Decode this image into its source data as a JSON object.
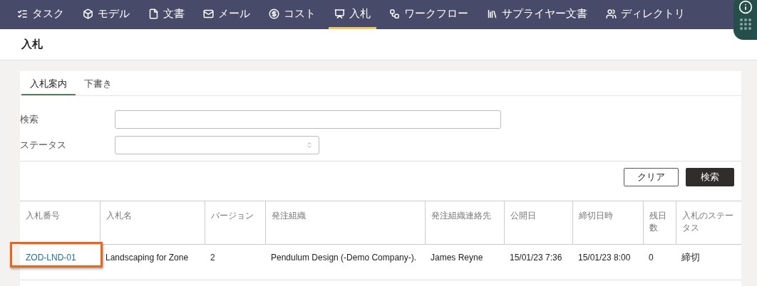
{
  "nav": {
    "items": [
      {
        "label": "タスク",
        "kind": "tasks",
        "selected": false
      },
      {
        "label": "モデル",
        "kind": "model",
        "selected": false
      },
      {
        "label": "文書",
        "kind": "document",
        "selected": false
      },
      {
        "label": "メール",
        "kind": "mail",
        "selected": false
      },
      {
        "label": "コスト",
        "kind": "cost",
        "selected": false
      },
      {
        "label": "入札",
        "kind": "bid",
        "selected": true
      },
      {
        "label": "ワークフロー",
        "kind": "workflow",
        "selected": false
      },
      {
        "label": "サプライヤー文書",
        "kind": "library",
        "selected": false
      },
      {
        "label": "ディレクトリ",
        "kind": "directory",
        "selected": false
      }
    ]
  },
  "page_title": "入札",
  "tabs": [
    {
      "label": "入札案内",
      "selected": true
    },
    {
      "label": "下書き",
      "selected": false
    }
  ],
  "filters": {
    "search_label": "検索",
    "status_label": "ステータス"
  },
  "buttons": {
    "clear": "クリア",
    "search": "検索"
  },
  "table": {
    "columns": [
      "入札番号",
      "入札名",
      "バージョン",
      "発注組織",
      "発注組織連絡先",
      "公開日",
      "締切日時",
      "残日数",
      "入札のステータス"
    ],
    "rows": [
      {
        "highlighted": true,
        "cells": [
          "ZOD-LND-01",
          "Landscaping for Zone",
          "2",
          "Pendulum Design (-Demo Company-).",
          "James Reyne",
          "15/01/23 7:36",
          "15/01/23 8:00",
          "0",
          "締切"
        ]
      }
    ]
  }
}
